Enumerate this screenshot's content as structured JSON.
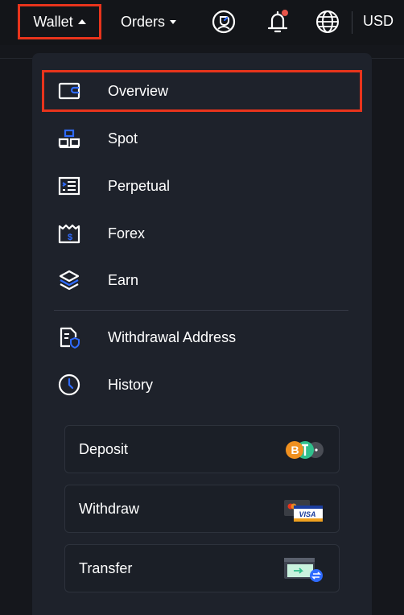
{
  "topbar": {
    "wallet_label": "Wallet",
    "orders_label": "Orders",
    "currency_label": "USD"
  },
  "menu": {
    "items": [
      {
        "label": "Overview",
        "icon": "wallet-icon",
        "active": true
      },
      {
        "label": "Spot",
        "icon": "blocks-icon"
      },
      {
        "label": "Perpetual",
        "icon": "document-list-icon"
      },
      {
        "label": "Forex",
        "icon": "dollar-receipt-icon"
      },
      {
        "label": "Earn",
        "icon": "layers-icon"
      },
      {
        "label": "Withdrawal Address",
        "icon": "shield-document-icon"
      },
      {
        "label": "History",
        "icon": "clock-icon"
      }
    ],
    "actions": [
      {
        "label": "Deposit",
        "icon": "crypto-coins-icon"
      },
      {
        "label": "Withdraw",
        "icon": "bank-cards-icon",
        "card_text": "VISA"
      },
      {
        "label": "Transfer",
        "icon": "transfer-card-icon"
      }
    ]
  },
  "colors": {
    "accent": "#2f6bff",
    "highlight": "#e8341c",
    "panel": "#1e222b",
    "notification_dot": "#e8554a"
  }
}
